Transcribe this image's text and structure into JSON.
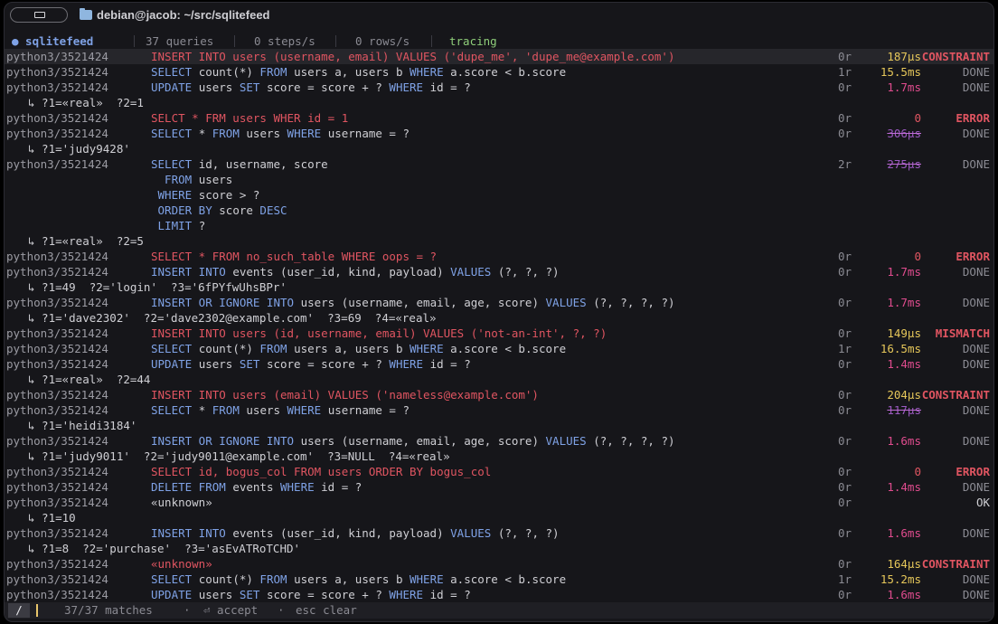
{
  "window": {
    "title": "debian@jacob: ~/src/sqlitefeed"
  },
  "status": {
    "app": "● sqlitefeed",
    "queries": "37 queries",
    "steps": "0 steps/s",
    "rows": "0 rows/s",
    "mode": "tracing"
  },
  "rows": [
    {
      "t": "q",
      "hl": true,
      "src": "python3/3521424",
      "err": true,
      "segs": [
        {
          "c": "err",
          "t": "INSERT INTO users (username, email) VALUES ('dupe_me', 'dupe_me@example.com')"
        }
      ],
      "cnt": "0r",
      "dur": "187µs",
      "dc": "d-y",
      "stat": "CONSTRAINT",
      "sc": "s-err"
    },
    {
      "t": "q",
      "src": "python3/3521424",
      "segs": [
        {
          "c": "kw",
          "t": "SELECT "
        },
        {
          "c": "tx",
          "t": "count(*) "
        },
        {
          "c": "kw",
          "t": "FROM "
        },
        {
          "c": "tx",
          "t": "users a, users b "
        },
        {
          "c": "kw",
          "t": "WHERE "
        },
        {
          "c": "tx",
          "t": "a.score < b.score"
        }
      ],
      "cnt": "1r",
      "dur": "15.5ms",
      "dc": "d-y",
      "stat": "DONE",
      "sc": "s-done"
    },
    {
      "t": "q",
      "src": "python3/3521424",
      "segs": [
        {
          "c": "kw",
          "t": "UPDATE "
        },
        {
          "c": "tx",
          "t": "users "
        },
        {
          "c": "kw",
          "t": "SET "
        },
        {
          "c": "tx",
          "t": "score = score + ? "
        },
        {
          "c": "kw",
          "t": "WHERE "
        },
        {
          "c": "tx",
          "t": "id = ?"
        }
      ],
      "cnt": "0r",
      "dur": "1.7ms",
      "dc": "d-m",
      "stat": "DONE",
      "sc": "s-done"
    },
    {
      "t": "p",
      "text": "↳ ?1=«real»  ?2=1"
    },
    {
      "t": "q",
      "src": "python3/3521424",
      "segs": [
        {
          "c": "err",
          "t": "SELCT * FRM users WHER id = 1"
        }
      ],
      "cnt": "0r",
      "dur": "0",
      "dc": "d-e",
      "stat": "ERROR",
      "sc": "s-err"
    },
    {
      "t": "q",
      "src": "python3/3521424",
      "segs": [
        {
          "c": "kw",
          "t": "SELECT "
        },
        {
          "c": "tx",
          "t": "* "
        },
        {
          "c": "kw",
          "t": "FROM "
        },
        {
          "c": "tx",
          "t": "users "
        },
        {
          "c": "kw",
          "t": "WHERE "
        },
        {
          "c": "tx",
          "t": "username = ?"
        }
      ],
      "cnt": "0r",
      "dur": "306µs",
      "dc": "d-s",
      "stat": "DONE",
      "sc": "s-done"
    },
    {
      "t": "p",
      "text": "↳ ?1='judy9428'"
    },
    {
      "t": "q",
      "src": "python3/3521424",
      "segs": [
        {
          "c": "kw",
          "t": "SELECT "
        },
        {
          "c": "tx",
          "t": "id, username, score"
        }
      ],
      "cnt": "2r",
      "dur": "275µs",
      "dc": "d-s",
      "stat": "DONE",
      "sc": "s-done"
    },
    {
      "t": "c",
      "segs": [
        {
          "c": "kw",
          "t": "  FROM "
        },
        {
          "c": "tx",
          "t": "users"
        }
      ]
    },
    {
      "t": "c",
      "segs": [
        {
          "c": "kw",
          "t": " WHERE "
        },
        {
          "c": "tx",
          "t": "score > ?"
        }
      ]
    },
    {
      "t": "c",
      "segs": [
        {
          "c": "kw",
          "t": " ORDER BY "
        },
        {
          "c": "tx",
          "t": "score "
        },
        {
          "c": "kw",
          "t": "DESC"
        }
      ]
    },
    {
      "t": "c",
      "segs": [
        {
          "c": "kw",
          "t": " LIMIT "
        },
        {
          "c": "tx",
          "t": "?"
        }
      ]
    },
    {
      "t": "p",
      "text": "↳ ?1=«real»  ?2=5"
    },
    {
      "t": "q",
      "src": "python3/3521424",
      "segs": [
        {
          "c": "err",
          "t": "SELECT * FROM no_such_table WHERE oops = ?"
        }
      ],
      "cnt": "0r",
      "dur": "0",
      "dc": "d-e",
      "stat": "ERROR",
      "sc": "s-err"
    },
    {
      "t": "q",
      "src": "python3/3521424",
      "segs": [
        {
          "c": "kw",
          "t": "INSERT INTO "
        },
        {
          "c": "tx",
          "t": "events (user_id, kind, payload) "
        },
        {
          "c": "kw",
          "t": "VALUES "
        },
        {
          "c": "tx",
          "t": "(?, ?, ?)"
        }
      ],
      "cnt": "0r",
      "dur": "1.7ms",
      "dc": "d-m",
      "stat": "DONE",
      "sc": "s-done"
    },
    {
      "t": "p",
      "text": "↳ ?1=49  ?2='login'  ?3='6fPYfwUhsBPr'"
    },
    {
      "t": "q",
      "src": "python3/3521424",
      "segs": [
        {
          "c": "kw",
          "t": "INSERT OR IGNORE INTO "
        },
        {
          "c": "tx",
          "t": "users (username, email, age, score) "
        },
        {
          "c": "kw",
          "t": "VALUES "
        },
        {
          "c": "tx",
          "t": "(?, ?, ?, ?)"
        }
      ],
      "cnt": "0r",
      "dur": "1.7ms",
      "dc": "d-m",
      "stat": "DONE",
      "sc": "s-done"
    },
    {
      "t": "p",
      "text": "↳ ?1='dave2302'  ?2='dave2302@example.com'  ?3=69  ?4=«real»"
    },
    {
      "t": "q",
      "src": "python3/3521424",
      "segs": [
        {
          "c": "err",
          "t": "INSERT INTO users (id, username, email) VALUES ('not-an-int', ?, ?)"
        }
      ],
      "cnt": "0r",
      "dur": "149µs",
      "dc": "d-y",
      "stat": "MISMATCH",
      "sc": "s-err"
    },
    {
      "t": "q",
      "src": "python3/3521424",
      "segs": [
        {
          "c": "kw",
          "t": "SELECT "
        },
        {
          "c": "tx",
          "t": "count(*) "
        },
        {
          "c": "kw",
          "t": "FROM "
        },
        {
          "c": "tx",
          "t": "users a, users b "
        },
        {
          "c": "kw",
          "t": "WHERE "
        },
        {
          "c": "tx",
          "t": "a.score < b.score"
        }
      ],
      "cnt": "1r",
      "dur": "16.5ms",
      "dc": "d-y",
      "stat": "DONE",
      "sc": "s-done"
    },
    {
      "t": "q",
      "src": "python3/3521424",
      "segs": [
        {
          "c": "kw",
          "t": "UPDATE "
        },
        {
          "c": "tx",
          "t": "users "
        },
        {
          "c": "kw",
          "t": "SET "
        },
        {
          "c": "tx",
          "t": "score = score + ? "
        },
        {
          "c": "kw",
          "t": "WHERE "
        },
        {
          "c": "tx",
          "t": "id = ?"
        }
      ],
      "cnt": "0r",
      "dur": "1.4ms",
      "dc": "d-m",
      "stat": "DONE",
      "sc": "s-done"
    },
    {
      "t": "p",
      "text": "↳ ?1=«real»  ?2=44"
    },
    {
      "t": "q",
      "src": "python3/3521424",
      "segs": [
        {
          "c": "err",
          "t": "INSERT INTO users (email) VALUES ('nameless@example.com')"
        }
      ],
      "cnt": "0r",
      "dur": "204µs",
      "dc": "d-y",
      "stat": "CONSTRAINT",
      "sc": "s-err"
    },
    {
      "t": "q",
      "src": "python3/3521424",
      "segs": [
        {
          "c": "kw",
          "t": "SELECT "
        },
        {
          "c": "tx",
          "t": "* "
        },
        {
          "c": "kw",
          "t": "FROM "
        },
        {
          "c": "tx",
          "t": "users "
        },
        {
          "c": "kw",
          "t": "WHERE "
        },
        {
          "c": "tx",
          "t": "username = ?"
        }
      ],
      "cnt": "0r",
      "dur": "117µs",
      "dc": "d-s",
      "stat": "DONE",
      "sc": "s-done"
    },
    {
      "t": "p",
      "text": "↳ ?1='heidi3184'"
    },
    {
      "t": "q",
      "src": "python3/3521424",
      "segs": [
        {
          "c": "kw",
          "t": "INSERT OR IGNORE INTO "
        },
        {
          "c": "tx",
          "t": "users (username, email, age, score) "
        },
        {
          "c": "kw",
          "t": "VALUES "
        },
        {
          "c": "tx",
          "t": "(?, ?, ?, ?)"
        }
      ],
      "cnt": "0r",
      "dur": "1.6ms",
      "dc": "d-m",
      "stat": "DONE",
      "sc": "s-done"
    },
    {
      "t": "p",
      "text": "↳ ?1='judy9011'  ?2='judy9011@example.com'  ?3=NULL  ?4=«real»"
    },
    {
      "t": "q",
      "src": "python3/3521424",
      "segs": [
        {
          "c": "err",
          "t": "SELECT id, bogus_col FROM users ORDER BY bogus_col"
        }
      ],
      "cnt": "0r",
      "dur": "0",
      "dc": "d-e",
      "stat": "ERROR",
      "sc": "s-err"
    },
    {
      "t": "q",
      "src": "python3/3521424",
      "segs": [
        {
          "c": "kw",
          "t": "DELETE FROM "
        },
        {
          "c": "tx",
          "t": "events "
        },
        {
          "c": "kw",
          "t": "WHERE "
        },
        {
          "c": "tx",
          "t": "id = ?"
        }
      ],
      "cnt": "0r",
      "dur": "1.4ms",
      "dc": "d-m",
      "stat": "DONE",
      "sc": "s-done"
    },
    {
      "t": "q",
      "src": "python3/3521424",
      "segs": [
        {
          "c": "tx",
          "t": "«unknown»"
        }
      ],
      "cnt": "0r",
      "dur": "",
      "dc": "d-y",
      "stat": "OK",
      "sc": "s-ok"
    },
    {
      "t": "p",
      "text": "↳ ?1=10"
    },
    {
      "t": "q",
      "src": "python3/3521424",
      "segs": [
        {
          "c": "kw",
          "t": "INSERT INTO "
        },
        {
          "c": "tx",
          "t": "events (user_id, kind, payload) "
        },
        {
          "c": "kw",
          "t": "VALUES "
        },
        {
          "c": "tx",
          "t": "(?, ?, ?)"
        }
      ],
      "cnt": "0r",
      "dur": "1.6ms",
      "dc": "d-m",
      "stat": "DONE",
      "sc": "s-done"
    },
    {
      "t": "p",
      "text": "↳ ?1=8  ?2='purchase'  ?3='asEvATRoTCHD'"
    },
    {
      "t": "q",
      "src": "python3/3521424",
      "segs": [
        {
          "c": "err",
          "t": "«unknown»"
        }
      ],
      "cnt": "0r",
      "dur": "164µs",
      "dc": "d-y",
      "stat": "CONSTRAINT",
      "sc": "s-err"
    },
    {
      "t": "q",
      "src": "python3/3521424",
      "segs": [
        {
          "c": "kw",
          "t": "SELECT "
        },
        {
          "c": "tx",
          "t": "count(*) "
        },
        {
          "c": "kw",
          "t": "FROM "
        },
        {
          "c": "tx",
          "t": "users a, users b "
        },
        {
          "c": "kw",
          "t": "WHERE "
        },
        {
          "c": "tx",
          "t": "a.score < b.score"
        }
      ],
      "cnt": "1r",
      "dur": "15.2ms",
      "dc": "d-y",
      "stat": "DONE",
      "sc": "s-done"
    },
    {
      "t": "q",
      "src": "python3/3521424",
      "segs": [
        {
          "c": "kw",
          "t": "UPDATE "
        },
        {
          "c": "tx",
          "t": "users "
        },
        {
          "c": "kw",
          "t": "SET "
        },
        {
          "c": "tx",
          "t": "score = score + ? "
        },
        {
          "c": "kw",
          "t": "WHERE "
        },
        {
          "c": "tx",
          "t": "id = ?"
        }
      ],
      "cnt": "0r",
      "dur": "1.6ms",
      "dc": "d-m",
      "stat": "DONE",
      "sc": "s-done"
    }
  ],
  "prompt": {
    "slash": "/",
    "matches": "37/37 matches",
    "dot1": "·",
    "accept": "⏎ accept",
    "dot2": "·",
    "clear": "esc clear"
  }
}
